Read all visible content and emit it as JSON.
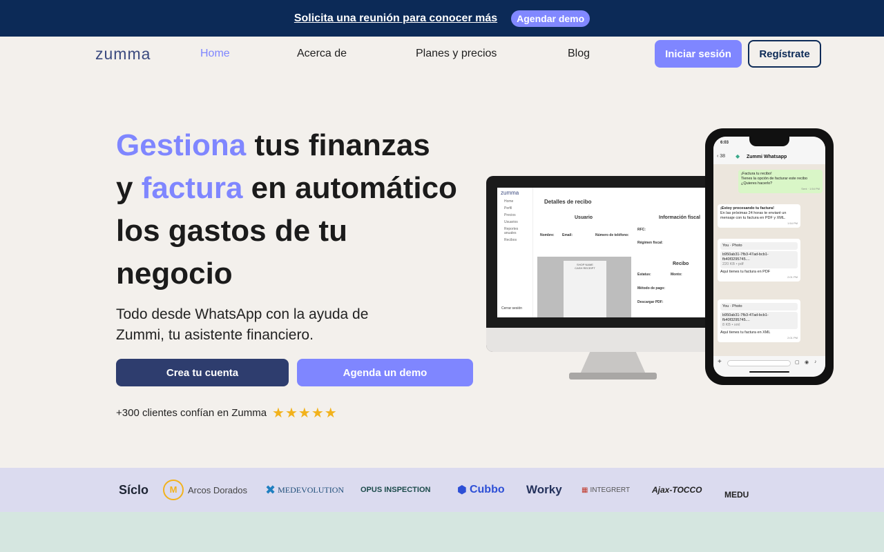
{
  "announcement": {
    "link_text": "Solicita una reunión para conocer más",
    "button_label": "Agendar demo"
  },
  "nav": {
    "logo": "zumma",
    "items": [
      {
        "label": "Home",
        "active": true
      },
      {
        "label": "Acerca de"
      },
      {
        "label": "Planes y precios"
      },
      {
        "label": "Blog"
      }
    ],
    "login_label": "Iniciar sesión",
    "register_label": "Regístrate"
  },
  "hero": {
    "title_line1_accent": "Gestiona",
    "title_line1_rest": " tus finanzas",
    "title_line2_start": "y ",
    "title_line2_accent": "factura",
    "title_line2_rest": " en automático",
    "title_line3": "los gastos de tu",
    "title_line4": "negocio",
    "subtitle": "Todo desde WhatsApp con la ayuda de Zummi, tu asistente financiero.",
    "cta_primary": "Crea tu cuenta",
    "cta_secondary": "Agenda un demo",
    "trust_text": "+300 clientes confían en Zumma",
    "rating_stars": 5
  },
  "desktop_mock": {
    "logo": "zumma",
    "sidebar_items": [
      "Home",
      "Perfil",
      "Precios",
      "Usuarios",
      "Reportes anuales",
      "Recibos"
    ],
    "page_title": "Detalles de recibo",
    "section_user": "Usuario",
    "section_fiscal": "Información fiscal",
    "section_receipt": "Recibo",
    "label_name": "Nombre:",
    "label_email": "Email:",
    "label_phone": "Número de teléfono:",
    "label_rfc": "RFC:",
    "label_regimen": "Régimen fiscal:",
    "label_status": "Estatus:",
    "label_amount": "Monto:",
    "label_payment": "Método de pago:",
    "label_download": "Descargar PDF:",
    "receipt_shop": "SHOP NAME",
    "receipt_sub": "CASH RECEIPT",
    "logout": "Cerrar sesión"
  },
  "phone_mock": {
    "time": "6:03",
    "back_count": "38",
    "chat_name": "Zummi Whatsapp",
    "msg_out_title": "¡Factura tu recibo!",
    "msg_out_body": "Tienes la opción de facturar este recibo ¿Quieres hacerlo?",
    "msg_out_sent": "Sent",
    "msg_out_time": "1:54 PM",
    "msg_in_1_title": "¡Estoy procesando tu factura!",
    "msg_in_1_body": "En las próximas 24 horas te enviaré un mensaje con tu factura en PDF y XML.",
    "msg_in_1_time": "1:54 PM",
    "reply_author": "You",
    "reply_type": "Photo",
    "file_name_1": "b950ab31-7fb3-47ad-bcb1-fb40f3295745....",
    "file_meta_1": "220 KB • pdf",
    "file_caption_1": "Aquí tienes tu factura en PDF",
    "file_time_1": "2:01 PM",
    "file_name_2": "b950ab31-7fb3-47ad-bcb1-fb40f3295745....",
    "file_meta_2": "8 KB • xml",
    "file_caption_2": "Aquí tienes tu factura en XML",
    "file_time_2": "2:01 PM"
  },
  "client_logos": [
    "Síclo",
    "Arcos Dorados",
    "MEDEVOLUTION",
    "OPUS INSPECTION",
    "Cubbo",
    "Worky",
    "INTEGRERT",
    "Ajax-TOCCO",
    "MEDU"
  ],
  "colors": {
    "announcement_bg": "#0c2a57",
    "accent": "#7f86ff",
    "primary_dark": "#2e3d6e",
    "page_bg": "#f3f0ec",
    "logo_strip_bg": "#dbdbef",
    "star": "#f2b21c"
  }
}
